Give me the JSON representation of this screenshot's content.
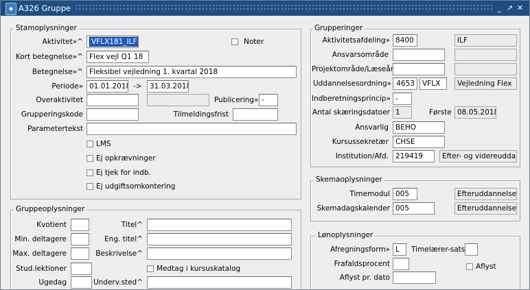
{
  "window": {
    "title": "A326 Gruppe"
  },
  "stamoplysninger": {
    "title": "Stamoplysninger",
    "aktivitet_label": "Aktivitet»^",
    "aktivitet_value": "VFLX181_ILF",
    "noter_label": "Noter",
    "kort_label": "Kort betegnelse»^",
    "kort_value": "Flex vejl Q1 18",
    "betegnelse_label": "Betegnelse»^",
    "betegnelse_value": "Fleksibel vejledning 1. kvartal 2018",
    "periode_label": "Periode»",
    "periode_from": "01.01.2018",
    "periode_sep": "->",
    "periode_to": "31.03.2018",
    "overaktivitet_label": "Overaktivitet",
    "overaktivitet_value": "",
    "overaktivitet_ro": "",
    "publicering_label": "Publicering»",
    "publicering_value": "-",
    "grupperingskode_label": "Grupperingskode",
    "grupperingskode_value": "",
    "tilmeldingsfrist_label": "Tilmeldingsfrist",
    "tilmeldingsfrist_value": "",
    "parametertekst_label": "Parametertekst",
    "parametertekst_value": "",
    "cb_lms": "LMS",
    "cb_opkraevninger": "Ej opkrævninger",
    "cb_tjek": "Ej tjek for indb.",
    "cb_udgift": "Ej udgiftsomkontering"
  },
  "grupperinger": {
    "title": "Grupperinger",
    "afd_label": "Aktivitetsafdeling»",
    "afd_value": "8400",
    "afd_desc": "ILF",
    "ansvar_label": "Ansvarsområde",
    "ansvar_value": "",
    "ansvar_desc": "",
    "projekt_label": "Projektområde/Læseår",
    "projekt_value": "",
    "projekt_desc": "",
    "udd_label": "Uddannelsesordning»",
    "udd_code": "4653",
    "udd_short": "VFLX",
    "udd_desc": "Vejledning Flex",
    "indb_label": "Indberetningsprincip»",
    "indb_value": "-",
    "antal_label": "Antal skæringsdatoer",
    "antal_value": "1",
    "forste_label": "Første",
    "forste_value": "08.05.2018",
    "ansvarlig_label": "Ansvarlig",
    "ansvarlig_value": "BEHO",
    "kursus_label": "Kursussekretær",
    "kursus_value": "CHSE",
    "inst_label": "Institution/Afd.",
    "inst_value": "219419",
    "inst_desc": "Efter- og videreuddannelse"
  },
  "gruppeoplysninger": {
    "title": "Gruppeoplysninger",
    "kvotient_label": "Kvotient",
    "kvotient_value": "",
    "titel_label": "Titel^",
    "titel_value": "",
    "min_label": "Min. deltagere",
    "min_value": "",
    "engtitel_label": "Eng. titel^",
    "engtitel_value": "",
    "max_label": "Max. deltagere",
    "max_value": "",
    "beskrivelse_label": "Beskrivelse^",
    "beskrivelse_value": "",
    "stud_label": "Stud.lektioner",
    "stud_value": "",
    "medtag_label": "Medtag i kursuskatalog",
    "ugedag_label": "Ugedag",
    "ugedag_value": "",
    "underv_label": "Underv.sted^",
    "underv_value": ""
  },
  "skemaoplysninger": {
    "title": "Skemaoplysninger",
    "timemodul_label": "Timemodul",
    "timemodul_value": "005",
    "timemodul_desc": "Efteruddannelse",
    "skemadag_label": "Skemadagskalender",
    "skemadag_value": "005",
    "skemadag_desc": "Efteruddannelse"
  },
  "lonoplysninger": {
    "title": "Lønoplysninger",
    "afregning_label": "Afregningsform»",
    "afregning_value": "L",
    "timelaerer_label": "Timelærer-sats",
    "timelaerer_value": "",
    "frafald_label": "Frafaldsprocent",
    "frafald_value": "",
    "aflyst_label": "Aflyst",
    "aflystdato_label": "Aflyst pr. dato",
    "aflystdato_value": ""
  }
}
